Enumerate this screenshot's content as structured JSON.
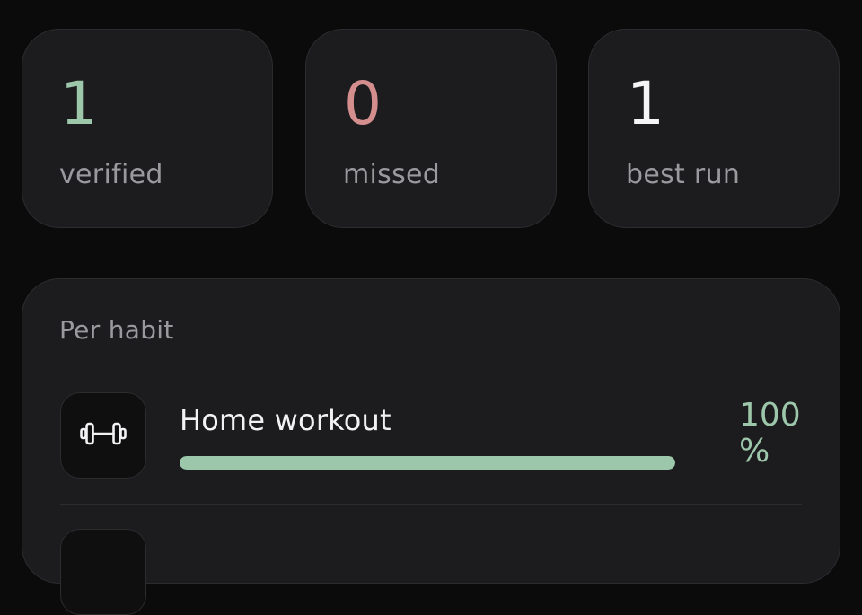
{
  "stats": {
    "verified": {
      "value": "1",
      "label": "verified",
      "color": "#9dc7ab"
    },
    "missed": {
      "value": "0",
      "label": "missed",
      "color": "#d48e8e"
    },
    "best_run": {
      "value": "1",
      "label": "best run",
      "color": "#f5f5f7"
    }
  },
  "per_habit": {
    "title": "Per habit",
    "habits": [
      {
        "name": "Home workout",
        "icon": "dumbbell-icon",
        "percent_text": "100 %",
        "progress": 1.0
      }
    ]
  },
  "colors": {
    "background": "#0b0b0c",
    "card": "#1c1c1e",
    "accent_green": "#9dc7ab",
    "accent_red": "#d48e8e",
    "muted_text": "#9a9a9e"
  }
}
